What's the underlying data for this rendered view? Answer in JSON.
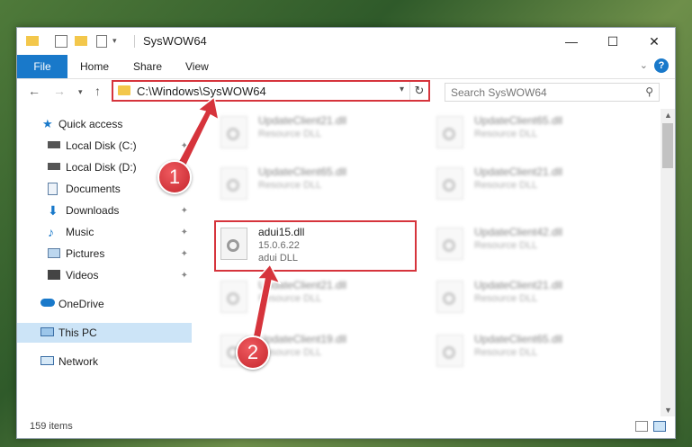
{
  "window": {
    "title": "SysWOW64"
  },
  "ribbon": {
    "tabs": [
      {
        "label": "File"
      },
      {
        "label": "Home"
      },
      {
        "label": "Share"
      },
      {
        "label": "View"
      }
    ],
    "help_icon": "?"
  },
  "navigation": {
    "address_path": "C:\\Windows\\SysWOW64",
    "search_placeholder": "Search SysWOW64"
  },
  "sidebar": {
    "items": [
      {
        "label": "Quick access",
        "icon": "star-icon"
      },
      {
        "label": "Local Disk (C:)",
        "icon": "drive-icon"
      },
      {
        "label": "Local Disk (D:)",
        "icon": "drive-icon"
      },
      {
        "label": "Documents",
        "icon": "documents-icon"
      },
      {
        "label": "Downloads",
        "icon": "download-icon"
      },
      {
        "label": "Music",
        "icon": "music-icon"
      },
      {
        "label": "Pictures",
        "icon": "pictures-icon"
      },
      {
        "label": "Videos",
        "icon": "videos-icon"
      },
      {
        "label": "OneDrive",
        "icon": "cloud-icon"
      },
      {
        "label": "This PC",
        "icon": "computer-icon"
      },
      {
        "label": "Network",
        "icon": "network-icon"
      }
    ]
  },
  "files": [
    {
      "name": "UpdateClient21.dll",
      "desc": "Resource DLL"
    },
    {
      "name": "UpdateClient65.dll",
      "desc": "Resource DLL"
    },
    {
      "name": "UpdateClient65.dll",
      "desc": "Resource DLL"
    },
    {
      "name": "UpdateClient21.dll",
      "desc": "Resource DLL"
    },
    {
      "name": "adui15.dll",
      "version": "15.0.6.22",
      "desc": "adui DLL"
    },
    {
      "name": "UpdateClient42.dll",
      "desc": "Resource DLL"
    },
    {
      "name": "UpdateClient21.dll",
      "desc": "Resource DLL"
    },
    {
      "name": "UpdateClient21.dll",
      "desc": "Resource DLL"
    },
    {
      "name": "UpdateClient19.dll",
      "desc": "Resource DLL"
    },
    {
      "name": "UpdateClient65.dll",
      "desc": "Resource DLL"
    }
  ],
  "status": {
    "item_count": "159 items"
  },
  "callouts": {
    "one": "1",
    "two": "2"
  },
  "colors": {
    "accent": "#1979ca",
    "highlight": "#d6343c",
    "selected_nav": "#cce4f7"
  }
}
